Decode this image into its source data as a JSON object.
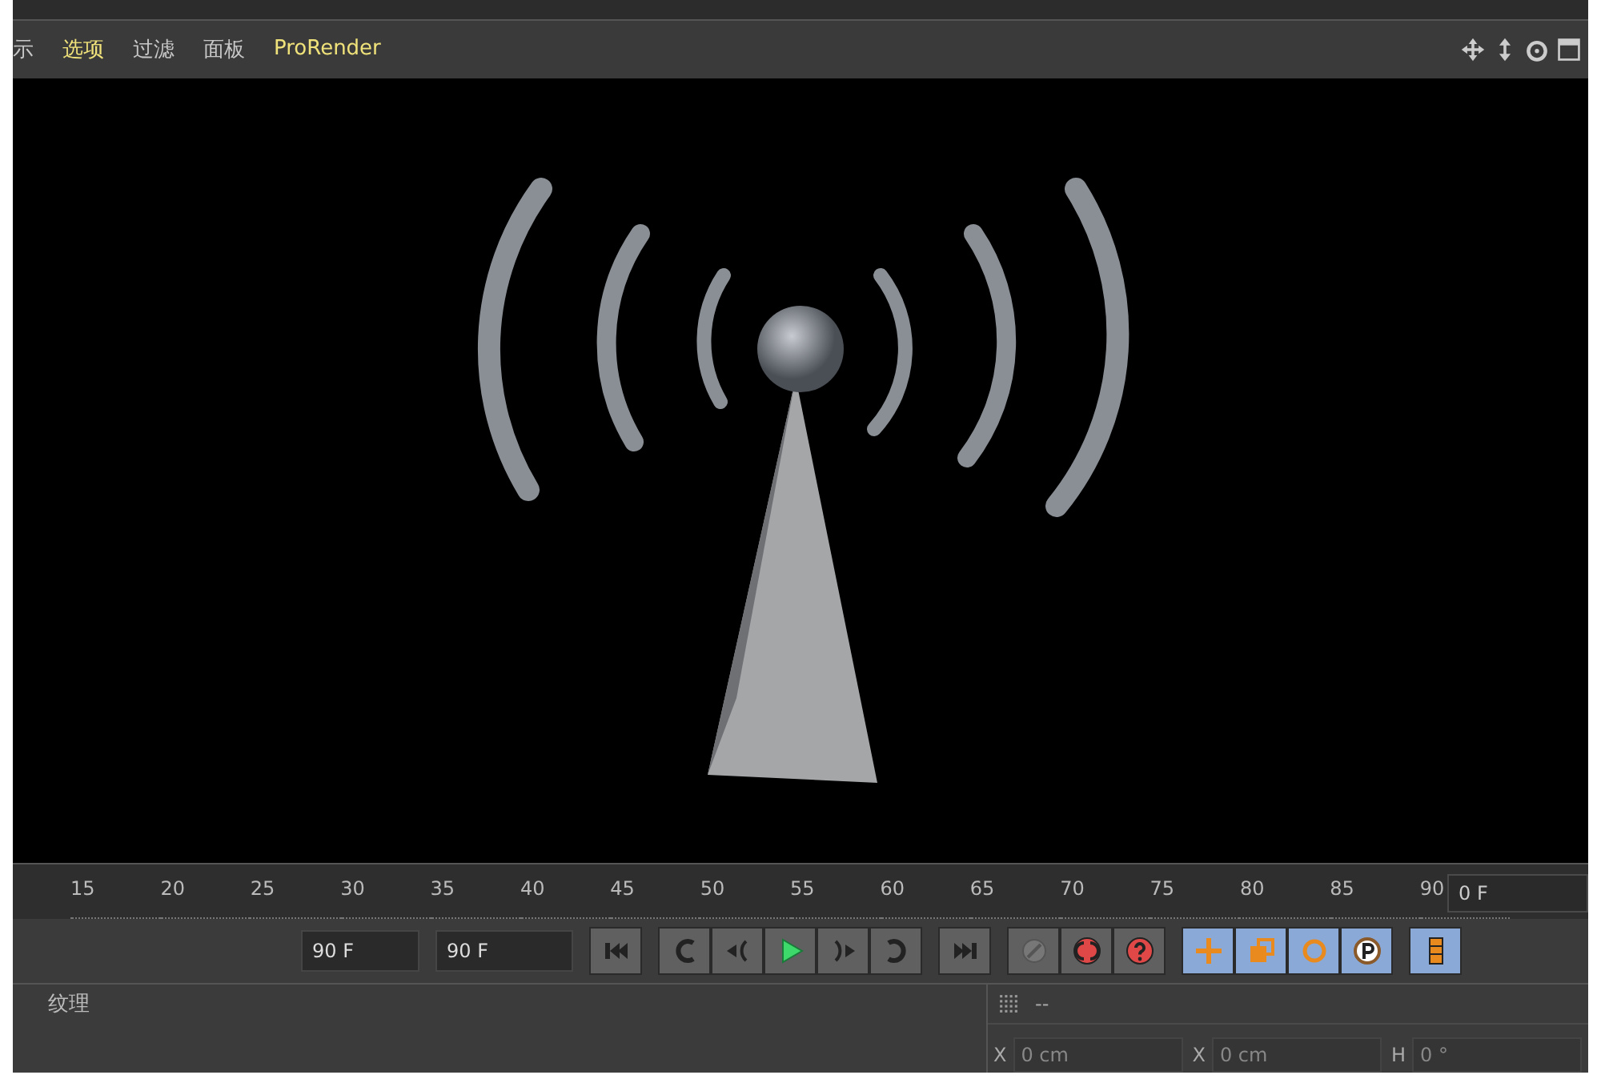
{
  "menu_bar": {
    "items": [
      {
        "label": "示",
        "highlighted": false
      },
      {
        "label": "选项",
        "highlighted": true
      },
      {
        "label": "过滤",
        "highlighted": false
      },
      {
        "label": "面板",
        "highlighted": false
      },
      {
        "label": "ProRender",
        "highlighted": true
      }
    ]
  },
  "timeline": {
    "ticks": [
      "15",
      "20",
      "25",
      "30",
      "35",
      "40",
      "45",
      "50",
      "55",
      "60",
      "65",
      "70",
      "75",
      "80",
      "85",
      "90"
    ],
    "current_frame": "0 F"
  },
  "transport": {
    "min_field": "90 F",
    "max_field": "90 F"
  },
  "bottom_panel": {
    "tabs": [
      "纹理"
    ],
    "header": "--",
    "fields": [
      {
        "axis": "X",
        "value": "0 cm"
      },
      {
        "axis": "X",
        "value": "0 cm"
      },
      {
        "axis": "H",
        "value": "0 °"
      }
    ]
  }
}
